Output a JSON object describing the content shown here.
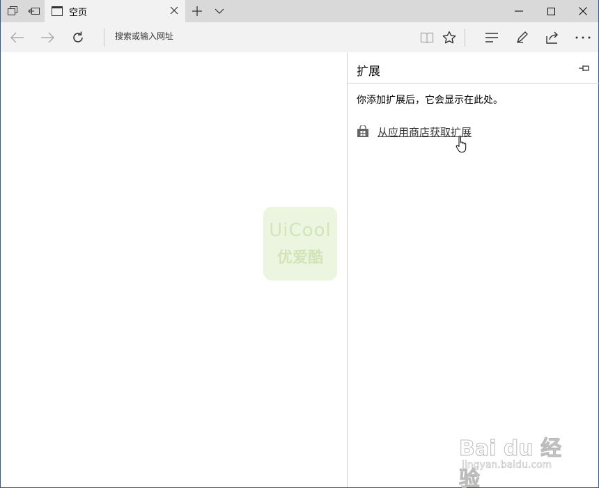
{
  "tab": {
    "title": "空页"
  },
  "address": {
    "placeholder": "搜索或输入网址"
  },
  "panel": {
    "title": "扩展",
    "message": "你添加扩展后，它会显示在此处。",
    "store_link": "从应用商店获取扩展"
  },
  "watermarks": {
    "uicool_top": "UiCool",
    "uicool_bottom": "优爱酷",
    "baidu_main": "Bai du 经验",
    "baidu_sub": "jingyan.baidu.com"
  },
  "colors": {
    "titlebar": "#d9d9d9",
    "toolbar": "#f2f2f2",
    "window_border": "#2b579a"
  }
}
